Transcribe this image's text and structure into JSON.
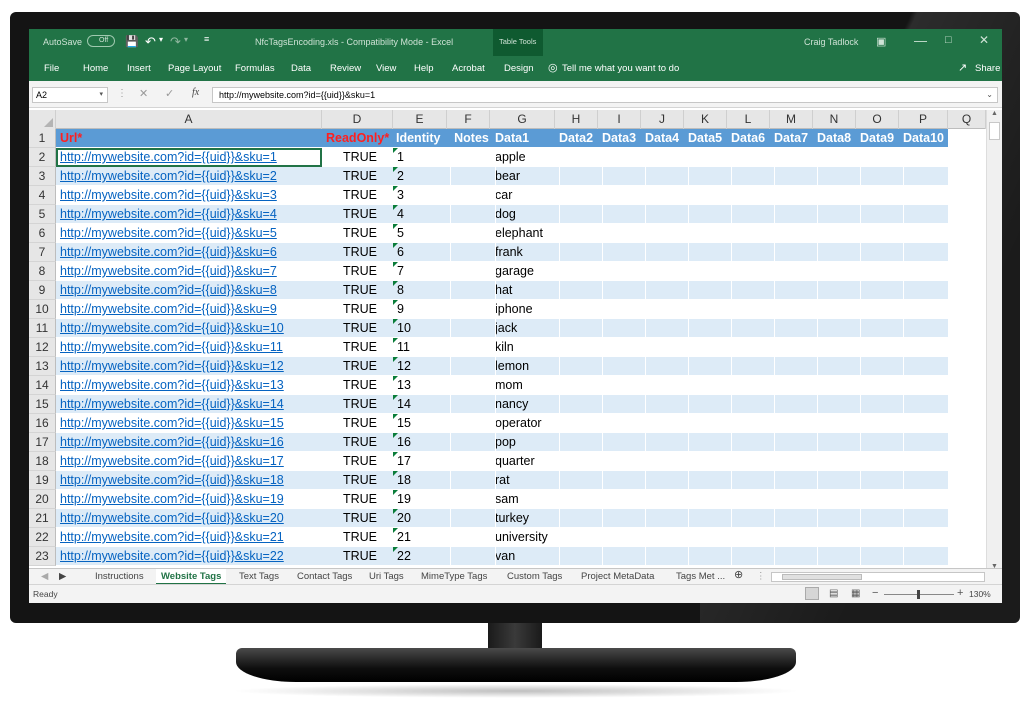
{
  "titlebar": {
    "autosave": "AutoSave",
    "autosave_state": "Off",
    "filename": "NfcTagsEncoding.xls  -  Compatibility Mode  -  Excel",
    "context_tab": "Table Tools",
    "user": "Craig Tadlock"
  },
  "ribbon": {
    "tabs": [
      "File",
      "Home",
      "Insert",
      "Page Layout",
      "Formulas",
      "Data",
      "Review",
      "View",
      "Help",
      "Acrobat",
      "Design"
    ],
    "tell_me": "Tell me what you want to do",
    "share": "Share"
  },
  "formula_bar": {
    "name_box": "A2",
    "fx": "fx",
    "formula": "http://mywebsite.com?id={{uid}}&sku=1"
  },
  "columns": [
    "A",
    "D",
    "E",
    "F",
    "G",
    "H",
    "I",
    "J",
    "K",
    "L",
    "M",
    "N",
    "O",
    "P",
    "Q"
  ],
  "table": {
    "headers": [
      "Url*",
      "ReadOnly*",
      "Identity",
      "Notes",
      "Data1",
      "Data2",
      "Data3",
      "Data4",
      "Data5",
      "Data6",
      "Data7",
      "Data8",
      "Data9",
      "Data10"
    ],
    "rows": [
      {
        "n": "2",
        "url": "http://mywebsite.com?id={{uid}}&sku=1",
        "ro": "TRUE",
        "id": "1",
        "data1": "apple"
      },
      {
        "n": "3",
        "url": "http://mywebsite.com?id={{uid}}&sku=2",
        "ro": "TRUE",
        "id": "2",
        "data1": "bear"
      },
      {
        "n": "4",
        "url": "http://mywebsite.com?id={{uid}}&sku=3",
        "ro": "TRUE",
        "id": "3",
        "data1": "car"
      },
      {
        "n": "5",
        "url": "http://mywebsite.com?id={{uid}}&sku=4",
        "ro": "TRUE",
        "id": "4",
        "data1": "dog"
      },
      {
        "n": "6",
        "url": "http://mywebsite.com?id={{uid}}&sku=5",
        "ro": "TRUE",
        "id": "5",
        "data1": "elephant"
      },
      {
        "n": "7",
        "url": "http://mywebsite.com?id={{uid}}&sku=6",
        "ro": "TRUE",
        "id": "6",
        "data1": "frank"
      },
      {
        "n": "8",
        "url": "http://mywebsite.com?id={{uid}}&sku=7",
        "ro": "TRUE",
        "id": "7",
        "data1": "garage"
      },
      {
        "n": "9",
        "url": "http://mywebsite.com?id={{uid}}&sku=8",
        "ro": "TRUE",
        "id": "8",
        "data1": "hat"
      },
      {
        "n": "10",
        "url": "http://mywebsite.com?id={{uid}}&sku=9",
        "ro": "TRUE",
        "id": "9",
        "data1": "iphone"
      },
      {
        "n": "11",
        "url": "http://mywebsite.com?id={{uid}}&sku=10",
        "ro": "TRUE",
        "id": "10",
        "data1": "jack"
      },
      {
        "n": "12",
        "url": "http://mywebsite.com?id={{uid}}&sku=11",
        "ro": "TRUE",
        "id": "11",
        "data1": "kiln"
      },
      {
        "n": "13",
        "url": "http://mywebsite.com?id={{uid}}&sku=12",
        "ro": "TRUE",
        "id": "12",
        "data1": "lemon"
      },
      {
        "n": "14",
        "url": "http://mywebsite.com?id={{uid}}&sku=13",
        "ro": "TRUE",
        "id": "13",
        "data1": "mom"
      },
      {
        "n": "15",
        "url": "http://mywebsite.com?id={{uid}}&sku=14",
        "ro": "TRUE",
        "id": "14",
        "data1": "nancy"
      },
      {
        "n": "16",
        "url": "http://mywebsite.com?id={{uid}}&sku=15",
        "ro": "TRUE",
        "id": "15",
        "data1": "operator"
      },
      {
        "n": "17",
        "url": "http://mywebsite.com?id={{uid}}&sku=16",
        "ro": "TRUE",
        "id": "16",
        "data1": "pop"
      },
      {
        "n": "18",
        "url": "http://mywebsite.com?id={{uid}}&sku=17",
        "ro": "TRUE",
        "id": "17",
        "data1": "quarter"
      },
      {
        "n": "19",
        "url": "http://mywebsite.com?id={{uid}}&sku=18",
        "ro": "TRUE",
        "id": "18",
        "data1": "rat"
      },
      {
        "n": "20",
        "url": "http://mywebsite.com?id={{uid}}&sku=19",
        "ro": "TRUE",
        "id": "19",
        "data1": "sam"
      },
      {
        "n": "21",
        "url": "http://mywebsite.com?id={{uid}}&sku=20",
        "ro": "TRUE",
        "id": "20",
        "data1": "turkey"
      },
      {
        "n": "22",
        "url": "http://mywebsite.com?id={{uid}}&sku=21",
        "ro": "TRUE",
        "id": "21",
        "data1": "university"
      },
      {
        "n": "23",
        "url": "http://mywebsite.com?id={{uid}}&sku=22",
        "ro": "TRUE",
        "id": "22",
        "data1": "van"
      }
    ]
  },
  "sheet_tabs": [
    "Instructions",
    "Website Tags",
    "Text Tags",
    "Contact Tags",
    "Uri Tags",
    "MimeType Tags",
    "Custom Tags",
    "Project MetaData",
    "Tags Met ..."
  ],
  "active_sheet": "Website Tags",
  "status": {
    "ready": "Ready",
    "zoom": "130%"
  },
  "colors": {
    "excel_green": "#217346",
    "header_blue": "#5b9bd5",
    "band_blue": "#ddebf7",
    "link_blue": "#0563c1",
    "required_red": "#ff1f1f"
  }
}
